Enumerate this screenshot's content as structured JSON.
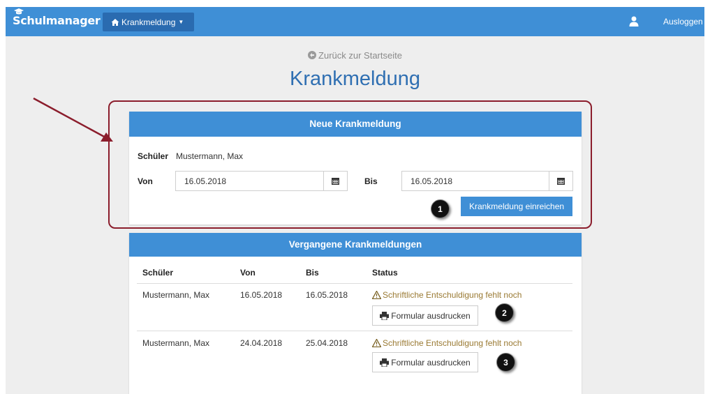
{
  "navbar": {
    "brand": "Schulmanager",
    "menu_label": "Krankmeldung",
    "logout_label": "Ausloggen"
  },
  "back_link": "Zurück zur Startseite",
  "page_title": "Krankmeldung",
  "new_panel": {
    "heading": "Neue Krankmeldung",
    "student_label": "Schüler",
    "student_value": "Mustermann, Max",
    "from_label": "Von",
    "from_value": "16.05.2018",
    "to_label": "Bis",
    "to_value": "16.05.2018",
    "submit_label": "Krankmeldung einreichen"
  },
  "past_panel": {
    "heading": "Vergangene Krankmeldungen",
    "columns": [
      "Schüler",
      "Von",
      "Bis",
      "Status"
    ],
    "rows": [
      {
        "student": "Mustermann, Max",
        "from": "16.05.2018",
        "to": "16.05.2018",
        "status": "Schriftliche Entschuldigung fehlt noch",
        "button": "Formular ausdrucken"
      },
      {
        "student": "Mustermann, Max",
        "from": "24.04.2018",
        "to": "25.04.2018",
        "status": "Schriftliche Entschuldigung fehlt noch",
        "button": "Formular ausdrucken"
      }
    ]
  },
  "callouts": [
    "1",
    "2",
    "3"
  ],
  "colors": {
    "primary": "#3f8fd6",
    "dropdown": "#2a6bb0",
    "title": "#2f6fb2",
    "warning": "#9a7a33",
    "highlight": "#8b1d2c"
  },
  "icons": [
    "graduation-cap-icon",
    "home-icon",
    "caret-down-icon",
    "user-icon",
    "arrow-circle-left-icon",
    "calendar-icon",
    "warning-icon",
    "print-icon",
    "annotation-arrow"
  ]
}
